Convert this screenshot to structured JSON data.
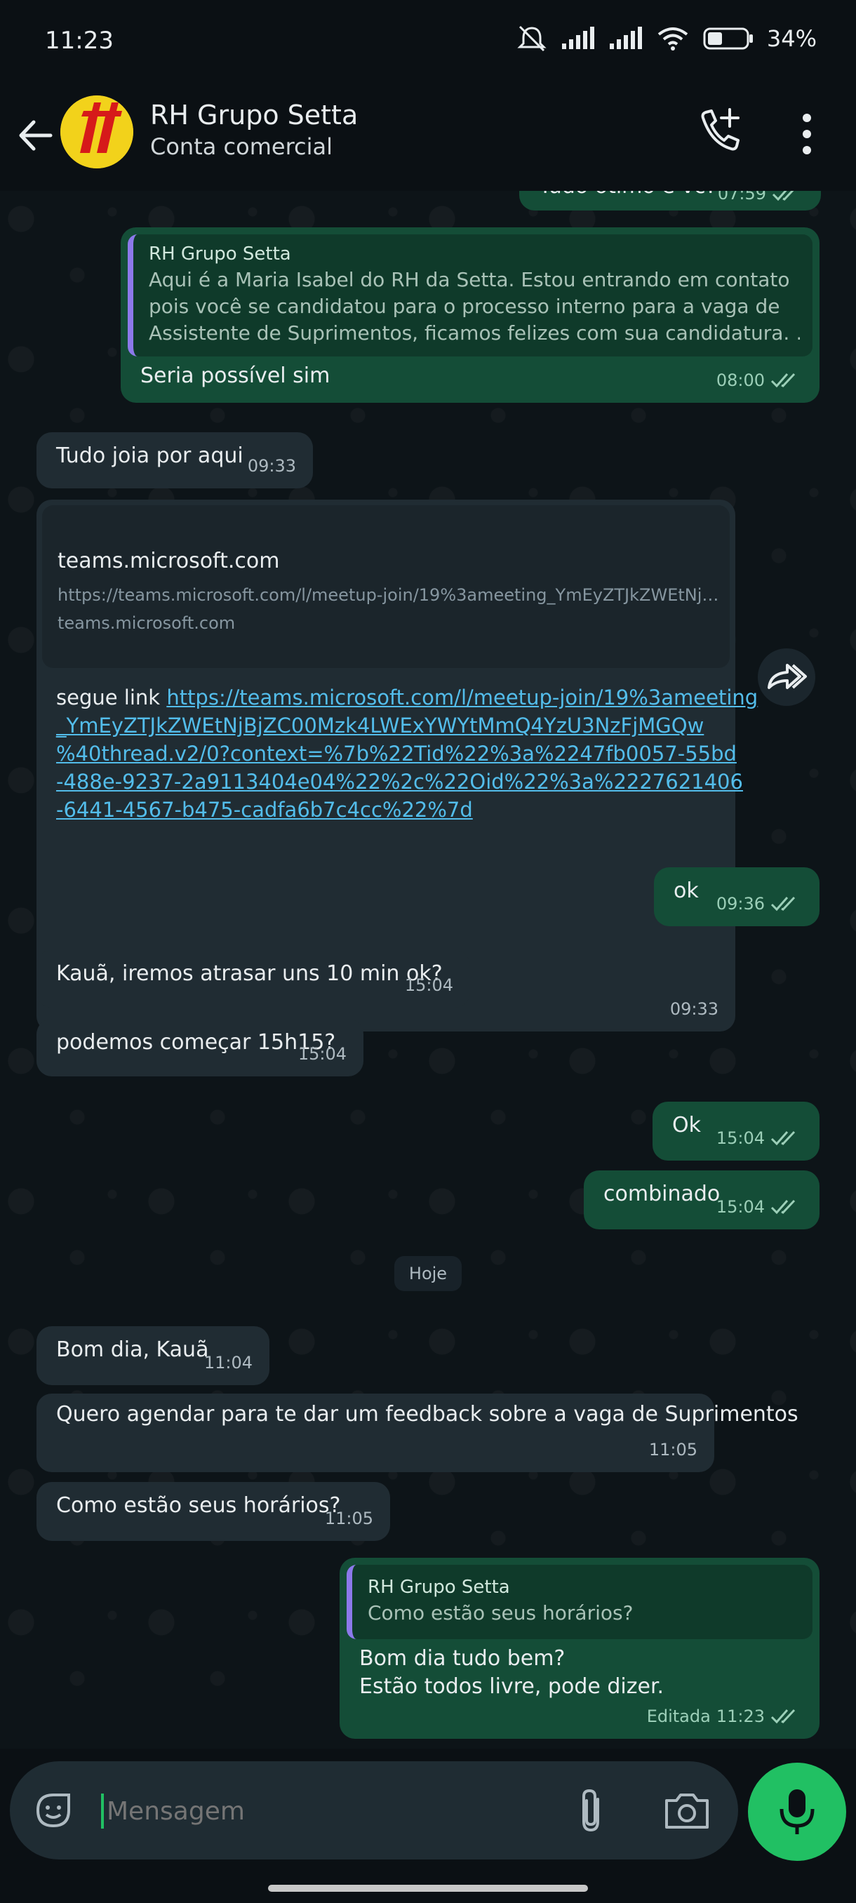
{
  "status_bar": {
    "time": "11:23",
    "battery": "34%"
  },
  "header": {
    "contact_name": "RH Grupo Setta",
    "subtitle": "Conta comercial"
  },
  "messages": {
    "m0": {
      "text": "Tudo ótimo e vc?",
      "time": "07:59"
    },
    "m1": {
      "quote_name": "RH Grupo Setta",
      "quote_line1": "Aqui é a Maria Isabel do RH da Setta. Estou entrando em contato",
      "quote_line2": "pois você se candidatou para o processo interno para a vaga de",
      "quote_line3": "Assistente de Suprimentos, ficamos felizes com sua candidatura. …",
      "text": "Seria possível sim",
      "time": "08:00"
    },
    "m2": {
      "text": "Tudo joia por aqui",
      "time": "09:33"
    },
    "m3": {
      "preview_title": "teams.microsoft.com",
      "preview_url": "https://teams.microsoft.com/l/meetup-join/19%3ameeting_YmEyZTJkZWEtNj…",
      "preview_domain": "teams.microsoft.com",
      "prefix": "segue link ",
      "link_line1": "https://teams.microsoft.com/l/meetup-join/19%3ameeting",
      "link_line2": "_YmEyZTJkZWEtNjBjZC00Mzk4LWExYWYtMmQ4YzU3NzFjMGQw",
      "link_line3": "%40thread.v2/0?context=%7b%22Tid%22%3a%2247fb0057-55bd",
      "link_line4": "-488e-9237-2a9113404e04%22%2c%22Oid%22%3a%2227621406",
      "link_line5": "-6441-4567-b475-cadfa6b7c4cc%22%7d",
      "time": "09:33"
    },
    "m4": {
      "text": "ok",
      "time": "09:36"
    },
    "m5": {
      "text": "Kauã, iremos atrasar uns 10 min ok?",
      "time": "15:04"
    },
    "m6": {
      "text": "podemos começar 15h15?",
      "time": "15:04"
    },
    "m7": {
      "text": "Ok",
      "time": "15:04"
    },
    "m8": {
      "text": "combinado",
      "time": "15:04"
    },
    "day": "Hoje",
    "m9": {
      "text": "Bom dia, Kauã",
      "time": "11:04"
    },
    "m10": {
      "text": "Quero agendar para te dar um feedback sobre a vaga de Suprimentos",
      "time": "11:05"
    },
    "m11": {
      "text": "Como estão seus horários?",
      "time": "11:05"
    },
    "m12": {
      "quote_name": "RH Grupo Setta",
      "quote_text": "Como estão seus horários?",
      "line1": "Bom dia tudo bem?",
      "line2": "Estão todos livre, pode dizer.",
      "edited": "Editada",
      "time": "11:23"
    }
  },
  "composer": {
    "placeholder": "Mensagem"
  },
  "colors": {
    "outgoing": "#144d37",
    "incoming": "#202c33",
    "accent": "#21c063",
    "link": "#53bdeb"
  },
  "icons": [
    "back-arrow-icon",
    "add-call-icon",
    "more-vert-icon",
    "forward-icon",
    "sticker-icon",
    "attach-icon",
    "camera-icon",
    "mic-icon",
    "double-check-icon"
  ]
}
